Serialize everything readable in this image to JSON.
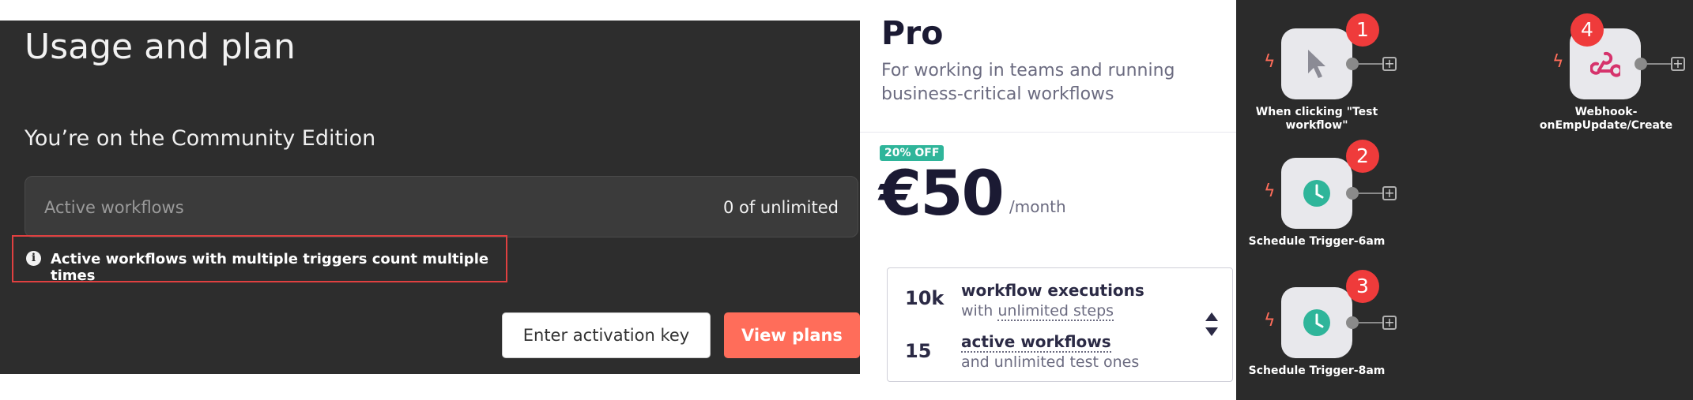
{
  "usage": {
    "title": "Usage and plan",
    "edition": "You’re on the Community Edition",
    "active_workflows_label": "Active workflows",
    "active_workflows_value": "0 of unlimited",
    "notice": "Active workflows with multiple triggers count multiple times",
    "enter_key_button": "Enter activation key",
    "view_plans_button": "View plans"
  },
  "plan": {
    "name": "Pro",
    "description": "For working in teams and running business-critical workflows",
    "discount": "20% OFF",
    "price": "€50",
    "period": "/month",
    "features": [
      {
        "number": "10k",
        "title": "workflow executions",
        "sub_prefix": "with ",
        "sub_link": "unlimited steps"
      },
      {
        "number": "15",
        "title": "active workflows",
        "sub": "and unlimited test ones"
      }
    ]
  },
  "canvas": {
    "nodes": [
      {
        "badge": "1",
        "label": "When clicking \"Test workflow\"",
        "icon": "cursor-icon"
      },
      {
        "badge": "2",
        "label": "Schedule Trigger-6am",
        "icon": "clock-icon"
      },
      {
        "badge": "3",
        "label": "Schedule Trigger-8am",
        "icon": "clock-icon"
      },
      {
        "badge": "4",
        "label": "Webhook-onEmpUpdate/Create",
        "icon": "webhook-icon"
      }
    ],
    "colors": {
      "trigger_bolt": "#ff6d5a",
      "badge": "#ef3b3b",
      "clock": "#2fb59a",
      "webhook": "#d6336c"
    }
  },
  "colors": {
    "accent": "#ff6d5a",
    "discount": "#2fb59a"
  }
}
